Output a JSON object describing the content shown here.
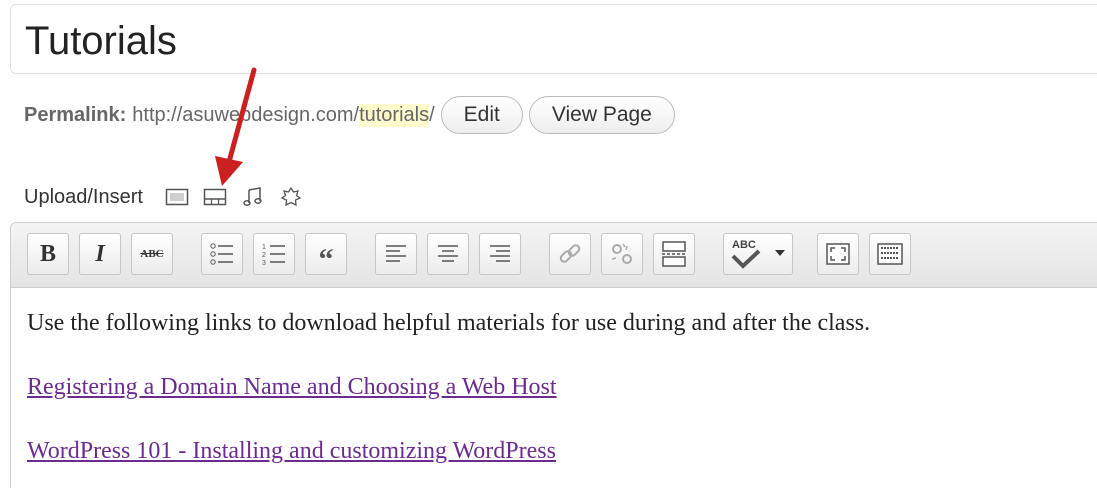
{
  "post": {
    "title": "Tutorials"
  },
  "permalink": {
    "label": "Permalink:",
    "url_prefix": "http://asuwebdesign.com/",
    "slug": "tutorials",
    "suffix": "/",
    "edit_label": "Edit",
    "view_label": "View Page"
  },
  "media": {
    "label": "Upload/Insert",
    "icons": [
      "add-image-icon",
      "add-gallery-icon",
      "add-audio-icon",
      "add-media-icon"
    ]
  },
  "toolbar": {
    "bold_label": "B",
    "italic_label": "I",
    "strike_label": "ABC",
    "spell_label": "ABC",
    "icons": [
      "bold-icon",
      "italic-icon",
      "strikethrough-icon",
      "bullet-list-icon",
      "numbered-list-icon",
      "blockquote-icon",
      "align-left-icon",
      "align-center-icon",
      "align-right-icon",
      "link-icon",
      "unlink-icon",
      "more-tag-icon",
      "spellcheck-icon",
      "fullscreen-icon",
      "kitchen-sink-icon"
    ]
  },
  "content": {
    "paragraph": "Use the following links to download helpful materials for use during and after the class.",
    "links": [
      "Registering a Domain Name and Choosing a Web Host",
      "WordPress 101 - Installing and customizing WordPress"
    ]
  },
  "colors": {
    "link": "#6b2c91",
    "annotation_arrow": "#cc1f1f",
    "slug_highlight": "#fffbcc"
  }
}
